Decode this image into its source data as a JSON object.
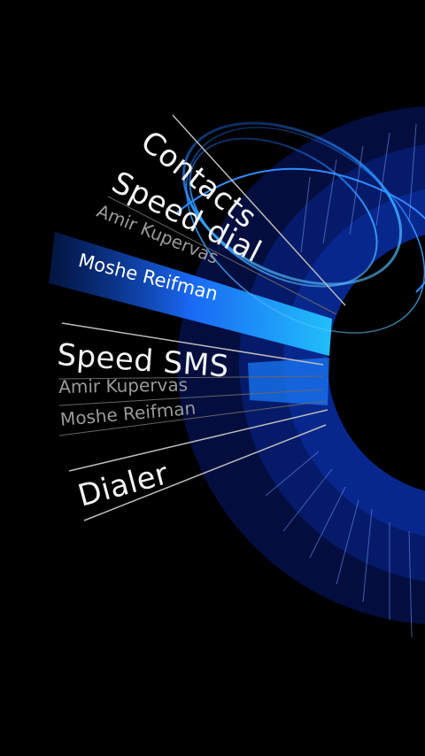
{
  "menu": {
    "contacts": "Contacts",
    "speed_dial": {
      "label": "Speed dial",
      "entries": [
        "Amir Kupervas",
        "Moshe Reifman"
      ],
      "selected_entry": "Moshe Reifman"
    },
    "speed_sms": {
      "label": "Speed SMS",
      "entries": [
        "Amir Kupervas",
        "Moshe Reifman"
      ]
    },
    "dialer": "Dialer"
  },
  "colors": {
    "background": "#000000",
    "accent": "#1a7dff",
    "ring_dark": "#0a1f66",
    "ring_mid": "#0b3fb3",
    "highlight": "#1fa3ff"
  },
  "icons": [
    "dialer-wheel-icon"
  ]
}
